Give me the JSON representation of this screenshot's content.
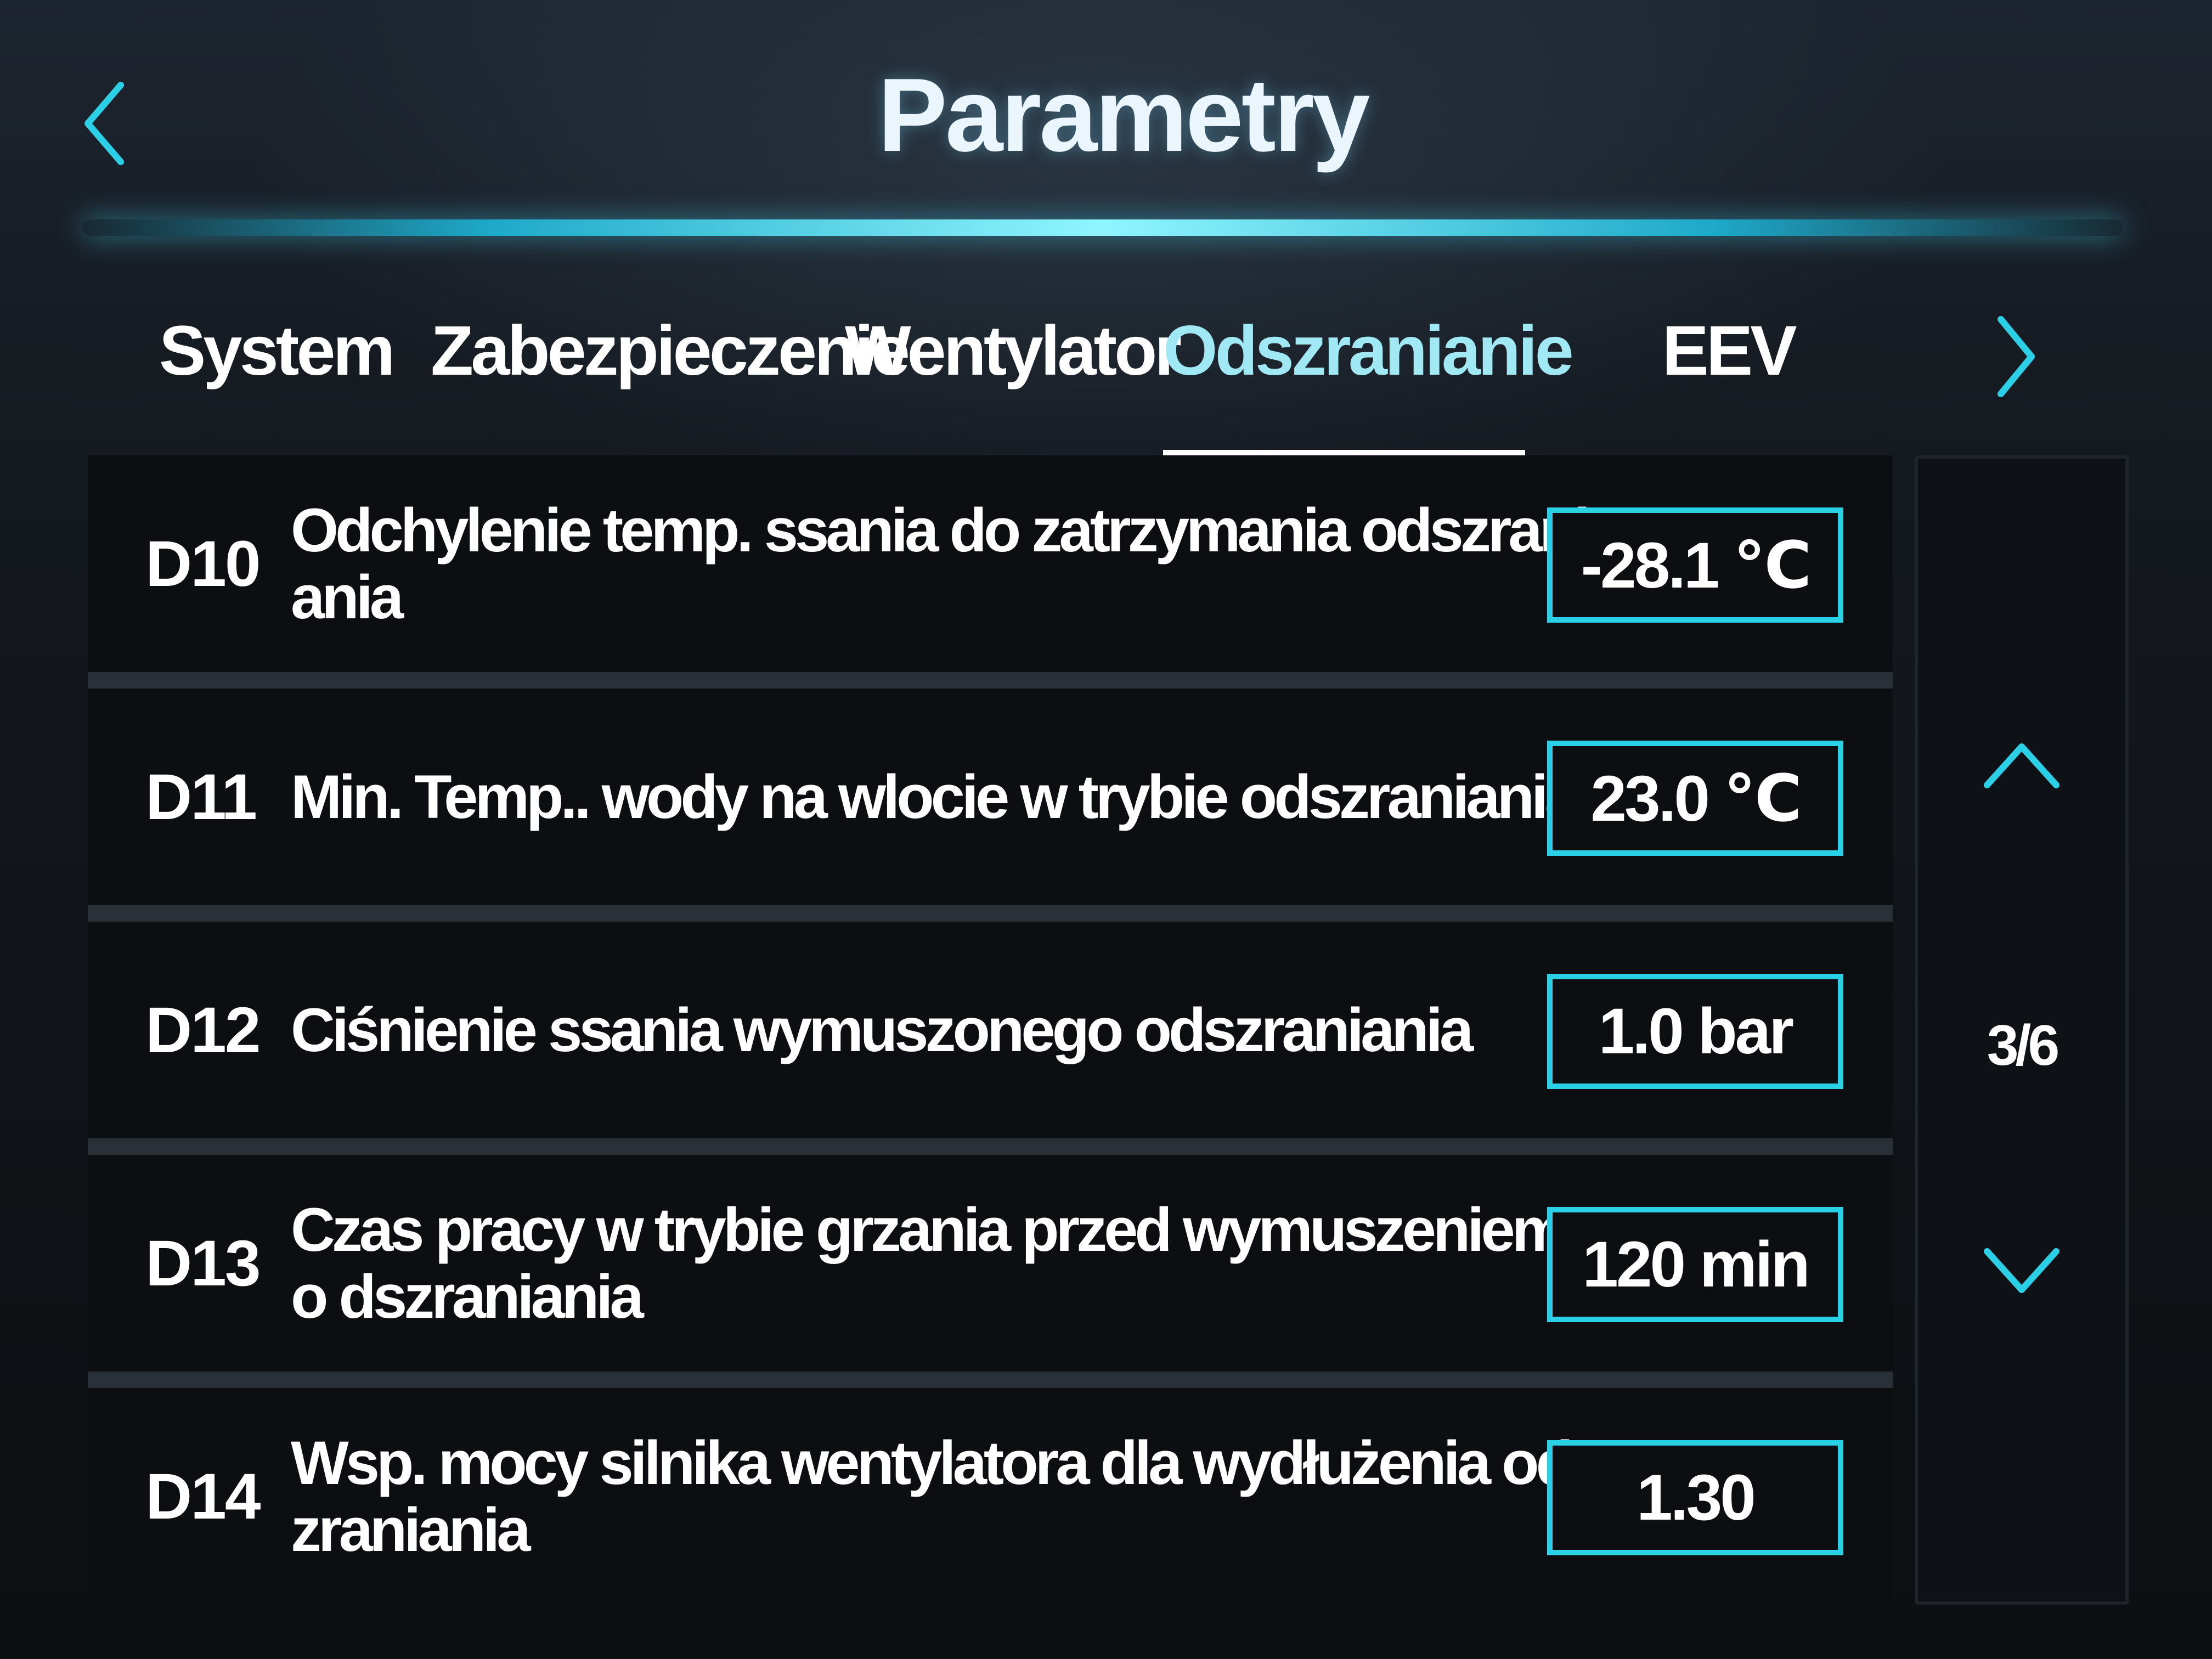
{
  "header": {
    "title": "Parametry",
    "back_icon": "chevron-left-icon"
  },
  "tabs": [
    {
      "label": "System",
      "active": false
    },
    {
      "label": "Zabezpieczenie",
      "active": false
    },
    {
      "label": "Wentylator",
      "active": false
    },
    {
      "label": "Odszranianie",
      "active": true
    },
    {
      "label": "EEV",
      "active": false
    }
  ],
  "tabs_next_icon": "chevron-right-icon",
  "parameters": [
    {
      "code": "D10",
      "label": "Odchylenie temp. ssania do zatrzymania odszrani ania",
      "value": "-28.1 ℃"
    },
    {
      "code": "D11",
      "label": "Min. Temp.. wody na wlocie w trybie odszraniania",
      "value": "23.0 ℃"
    },
    {
      "code": "D12",
      "label": "Ciśnienie ssania wymuszonego odszraniania",
      "value": "1.0 bar"
    },
    {
      "code": "D13",
      "label": "Czas pracy w trybie grzania przed wymuszeniem o dszraniania",
      "value": "120 min"
    },
    {
      "code": "D14",
      "label": "Wsp. mocy silnika wentylatora dla wydłużenia ods zraniania",
      "value": "1.30"
    }
  ],
  "pagination": {
    "indicator": "3/6",
    "up_icon": "chevron-up-icon",
    "down_icon": "chevron-down-icon"
  },
  "colors": {
    "accent": "#2ad0e6",
    "active_tab": "#9fe8f4",
    "text": "#ffffff",
    "background": "#0c0e11"
  }
}
